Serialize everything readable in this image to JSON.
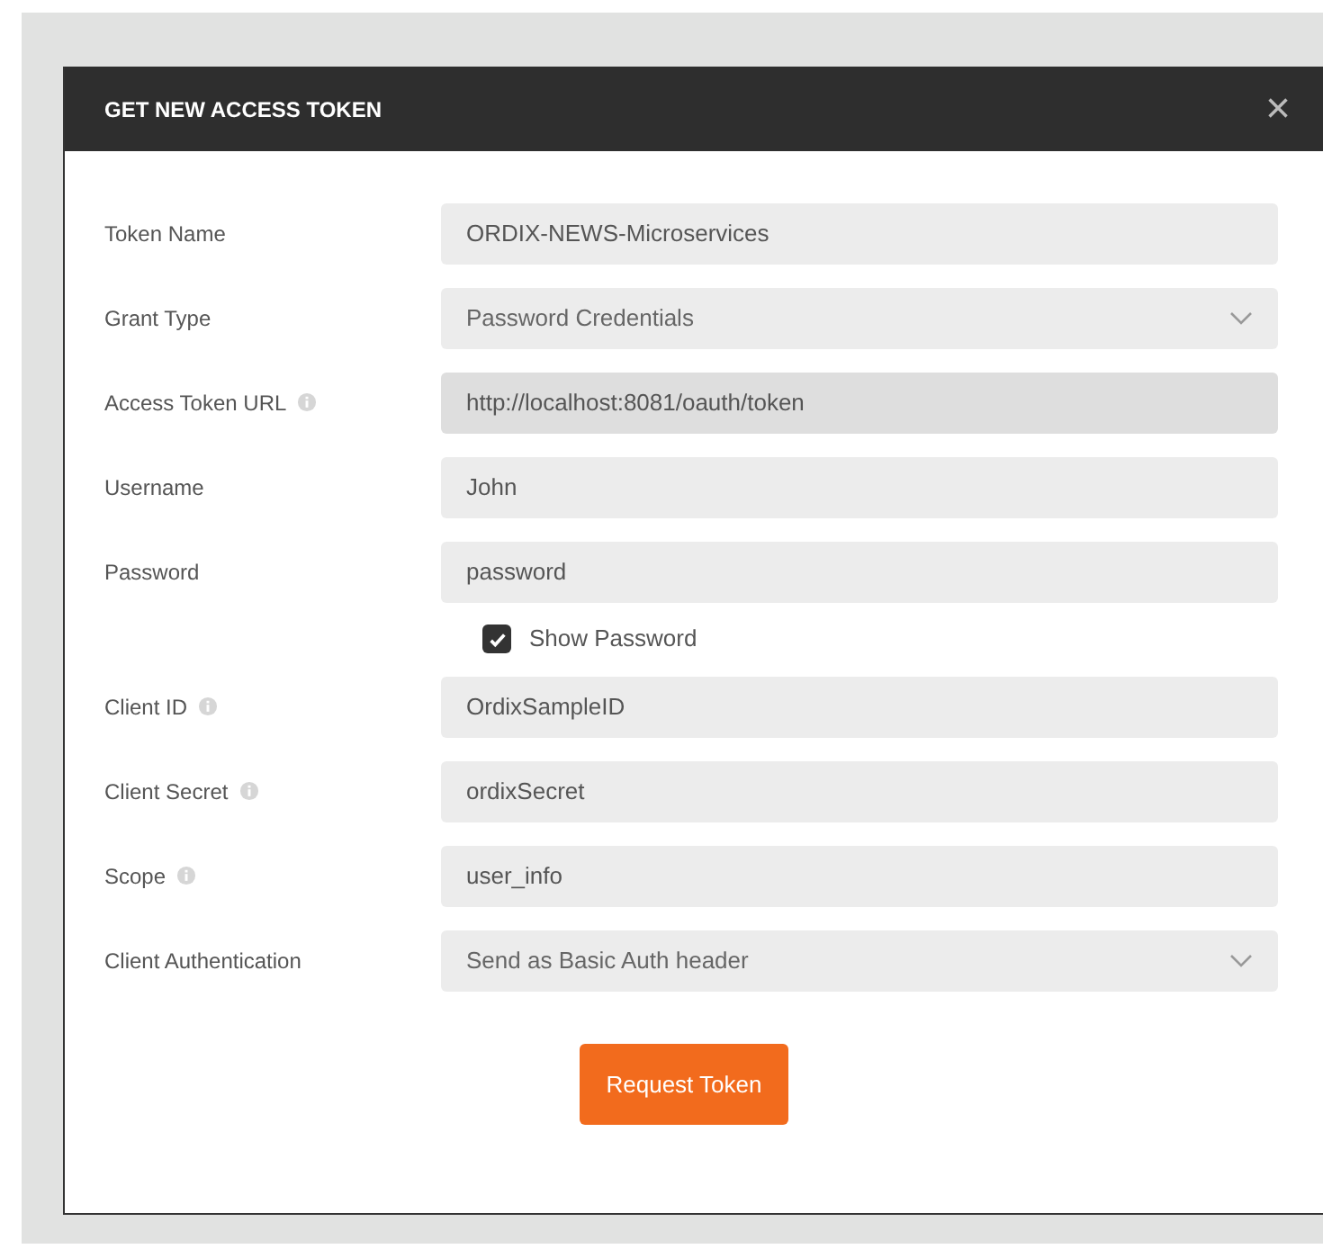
{
  "dialog": {
    "title": "GET NEW ACCESS TOKEN",
    "close": "×"
  },
  "fields": [
    {
      "label": "Token Name",
      "kind": "text",
      "info": false,
      "value": "ORDIX-NEWS-Microservices"
    },
    {
      "label": "Grant Type",
      "kind": "select",
      "info": false,
      "value": "Password Credentials"
    },
    {
      "label": "Access Token URL",
      "kind": "readonly",
      "info": true,
      "value": "http://localhost:8081/oauth/token"
    },
    {
      "label": "Username",
      "kind": "text",
      "info": false,
      "value": "John"
    },
    {
      "label": "Password",
      "kind": "text",
      "info": false,
      "value": "password"
    },
    {
      "label": "Show Password",
      "kind": "checkbox",
      "checked": true
    },
    {
      "label": "Client ID",
      "kind": "text",
      "info": true,
      "value": "OrdixSampleID"
    },
    {
      "label": "Client Secret",
      "kind": "text",
      "info": true,
      "value": "ordixSecret"
    },
    {
      "label": "Scope",
      "kind": "text",
      "info": true,
      "value": "user_info"
    },
    {
      "label": "Client Authentication",
      "kind": "select",
      "info": false,
      "value": "Send as Basic Auth header"
    }
  ],
  "button": "Request Token"
}
